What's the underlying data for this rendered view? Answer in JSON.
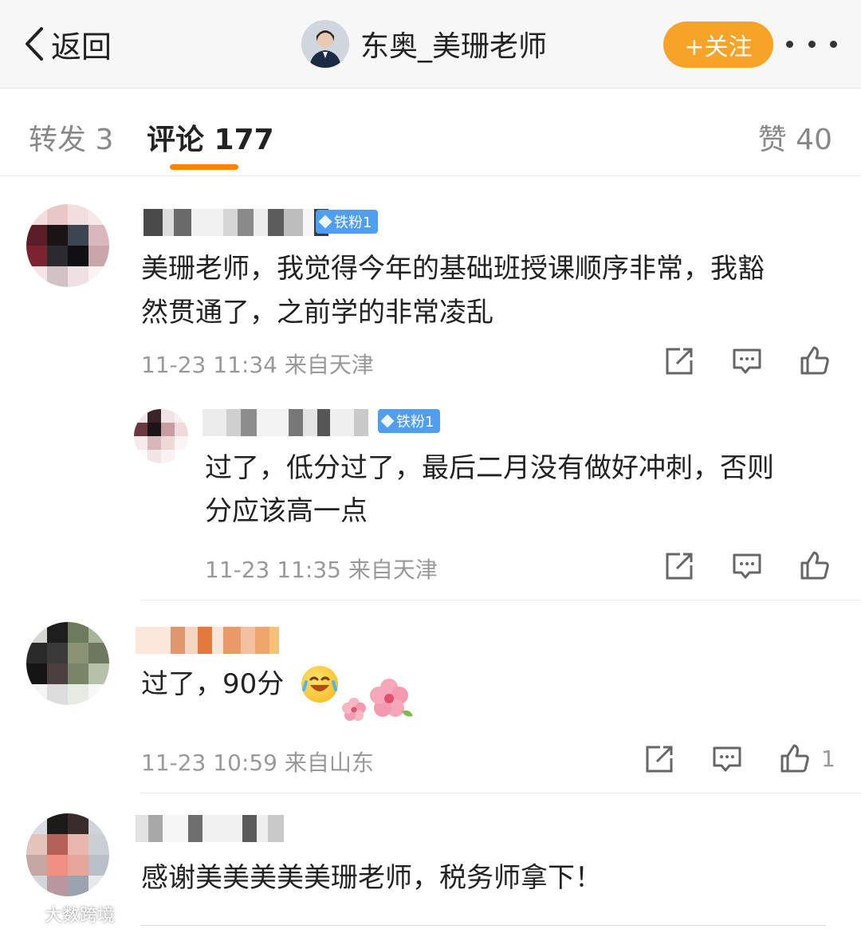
{
  "nav": {
    "back_label": "返回",
    "account_name": "东奥_美珊老师",
    "follow_label": "+关注"
  },
  "tabs": {
    "repost": "转发 3",
    "comment": "评论 177",
    "like": "赞 40"
  },
  "comments": [
    {
      "badge": "铁粉1",
      "text_line1": "美珊老师，我觉得今年的基础班授课顺序非常，我豁",
      "text_line2": "然贯通了，之前学的非常凌乱",
      "time": "11-23 11:34 来自天津"
    },
    {
      "badge": "铁粉1",
      "text_line1": "过了，低分过了，最后二月没有做好冲刺，否则",
      "text_line2": "分应该高一点",
      "time": "11-23 11:35 来自天津"
    },
    {
      "text_line1": "过了，90分",
      "time": "11-23 10:59 来自山东",
      "like_count": "1"
    },
    {
      "text_line1": "感谢美美美美美珊老师，税务师拿下！"
    }
  ],
  "watermark": "大数跨境",
  "icons": [
    "back-chevron-icon",
    "more-dots-icon",
    "share-icon",
    "comment-icon",
    "like-icon",
    "diamond-icon",
    "laughing-emoji-icon",
    "flower-icon"
  ]
}
